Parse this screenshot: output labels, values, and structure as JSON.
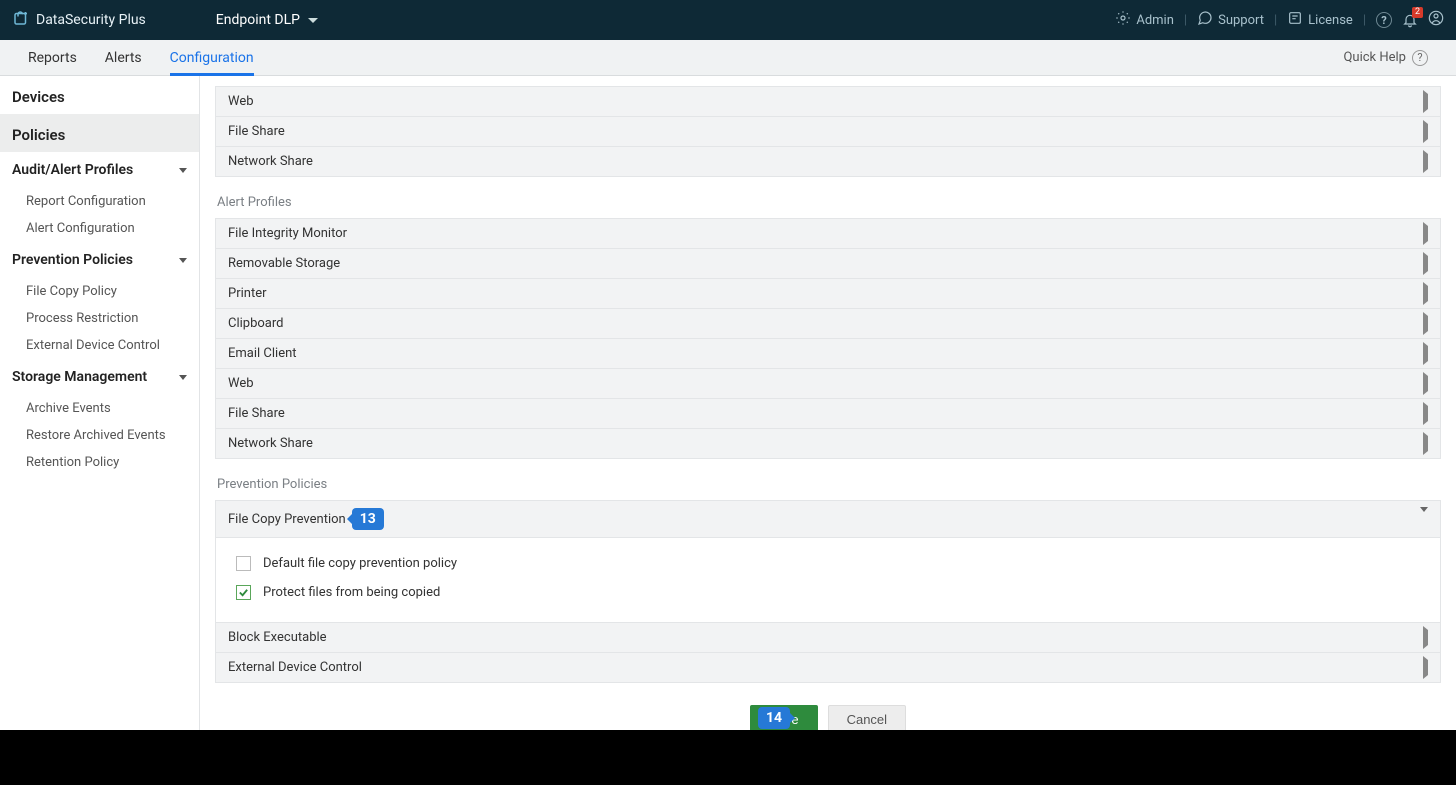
{
  "brand": {
    "name": "DataSecurity Plus"
  },
  "module": {
    "current": "Endpoint DLP"
  },
  "topbar": {
    "admin": "Admin",
    "support": "Support",
    "license": "License",
    "notification_count": "2"
  },
  "tabs": {
    "reports": "Reports",
    "alerts": "Alerts",
    "configuration": "Configuration",
    "quick_help": "Quick Help"
  },
  "sidebar": {
    "devices": "Devices",
    "policies": "Policies",
    "audit_alert": {
      "label": "Audit/Alert Profiles",
      "items": [
        "Report Configuration",
        "Alert Configuration"
      ]
    },
    "prevention": {
      "label": "Prevention Policies",
      "items": [
        "File Copy Policy",
        "Process Restriction",
        "External Device Control"
      ]
    },
    "storage": {
      "label": "Storage Management",
      "items": [
        "Archive Events",
        "Restore Archived Events",
        "Retention Policy"
      ]
    }
  },
  "sections": {
    "upper_rows": [
      "Web",
      "File Share",
      "Network Share"
    ],
    "alert_profiles": {
      "title": "Alert Profiles",
      "rows": [
        "File Integrity Monitor",
        "Removable Storage",
        "Printer",
        "Clipboard",
        "Email Client",
        "Web",
        "File Share",
        "Network Share"
      ]
    },
    "prevention_policies": {
      "title": "Prevention Policies",
      "expanded_row": "File Copy Prevention",
      "checkboxes": [
        {
          "label": "Default file copy prevention policy",
          "checked": false
        },
        {
          "label": "Protect files from being copied",
          "checked": true
        }
      ],
      "rows_after": [
        "Block Executable",
        "External Device Control"
      ]
    }
  },
  "callouts": {
    "c13": "13",
    "c14": "14"
  },
  "actions": {
    "save": "Save",
    "cancel": "Cancel"
  }
}
